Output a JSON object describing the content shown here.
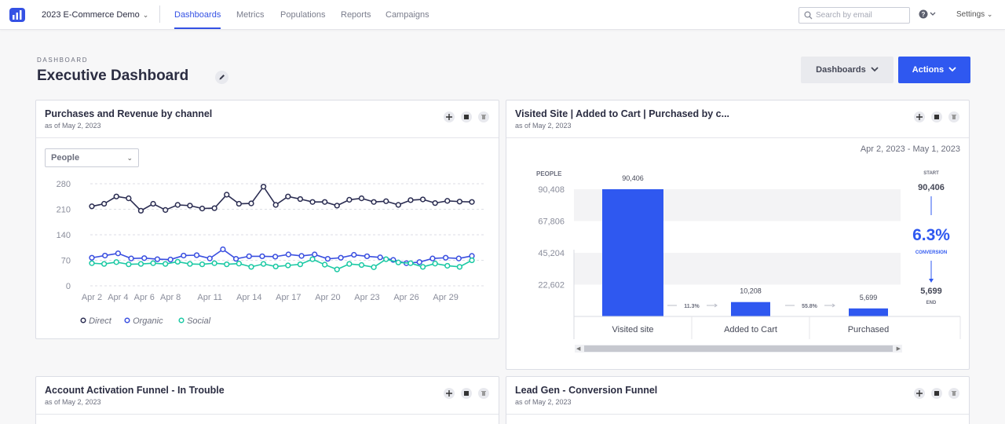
{
  "nav": {
    "project": "2023 E-Commerce Demo",
    "items": [
      {
        "label": "Dashboards",
        "active": true
      },
      {
        "label": "Metrics",
        "active": false
      },
      {
        "label": "Populations",
        "active": false
      },
      {
        "label": "Reports",
        "active": false
      },
      {
        "label": "Campaigns",
        "active": false
      }
    ],
    "search_placeholder": "Search by email",
    "settings_label": "Settings"
  },
  "header": {
    "breadcrumb": "DASHBOARD",
    "title": "Executive Dashboard",
    "dashboards_button": "Dashboards",
    "actions_button": "Actions"
  },
  "colors": {
    "accent": "#2f58f0",
    "direct": "#2b2d52",
    "organic": "#3a4fe0",
    "social": "#1bc9a4",
    "funnel_bar": "#2f58f0"
  },
  "cards": {
    "purchases": {
      "title": "Purchases and Revenue by channel",
      "subtitle": "as of May 2, 2023",
      "select_value": "People",
      "legend": [
        "Direct",
        "Organic",
        "Social"
      ]
    },
    "funnel": {
      "title": "Visited Site | Added to Cart | Purchased by c...",
      "subtitle": "as of May 2, 2023",
      "date_range": "Apr 2, 2023 - May 1, 2023",
      "y_label": "PEOPLE",
      "start_label": "START",
      "start_value": "90,406",
      "conversion_value": "6.3%",
      "conversion_label": "CONVERSION",
      "end_value": "5,699",
      "end_label": "END"
    },
    "activation": {
      "title": "Account Activation Funnel - In Trouble",
      "subtitle": "as of May 2, 2023"
    },
    "leadgen": {
      "title": "Lead Gen - Conversion Funnel",
      "subtitle": "as of May 2, 2023"
    }
  },
  "chart_data": [
    {
      "type": "line",
      "x_tick_labels": [
        "Apr 2",
        "Apr 4",
        "Apr 6",
        "Apr 8",
        "Apr 11",
        "Apr 14",
        "Apr 17",
        "Apr 20",
        "Apr 23",
        "Apr 26",
        "Apr 29"
      ],
      "y_ticks": [
        0,
        70,
        140,
        210,
        280
      ],
      "ylim": [
        0,
        280
      ],
      "grid": true,
      "legend_position": "bottom-left",
      "series": [
        {
          "name": "Direct",
          "values": [
            218,
            225,
            245,
            240,
            206,
            225,
            208,
            222,
            220,
            212,
            213,
            250,
            225,
            226,
            272,
            222,
            245,
            238,
            230,
            230,
            220,
            236,
            240,
            230,
            232,
            222,
            235,
            237,
            227,
            233,
            231,
            230
          ]
        },
        {
          "name": "Organic",
          "values": [
            77,
            83,
            89,
            75,
            76,
            73,
            72,
            83,
            84,
            75,
            100,
            74,
            81,
            81,
            80,
            86,
            82,
            86,
            74,
            77,
            85,
            81,
            78,
            71,
            62,
            65,
            75,
            77,
            75,
            82
          ]
        },
        {
          "name": "Social",
          "values": [
            62,
            60,
            65,
            59,
            60,
            62,
            60,
            66,
            60,
            59,
            62,
            59,
            61,
            52,
            60,
            53,
            56,
            59,
            73,
            58,
            45,
            60,
            57,
            51,
            73,
            64,
            62,
            52,
            61,
            55,
            52,
            70
          ]
        }
      ]
    },
    {
      "type": "bar",
      "categories": [
        "Visited site",
        "Added to Cart",
        "Purchased"
      ],
      "values": [
        90406,
        10208,
        5699
      ],
      "value_labels": [
        "90,406",
        "10,208",
        "5,699"
      ],
      "step_rates": [
        "11.3%",
        "55.8%"
      ],
      "y_tick_labels": [
        "90,408",
        "67,806",
        "45,204",
        "22,602"
      ],
      "y_ticks": [
        90408,
        67806,
        45204,
        22602
      ],
      "ylim": [
        0,
        90408
      ],
      "ylabel": "PEOPLE"
    }
  ]
}
